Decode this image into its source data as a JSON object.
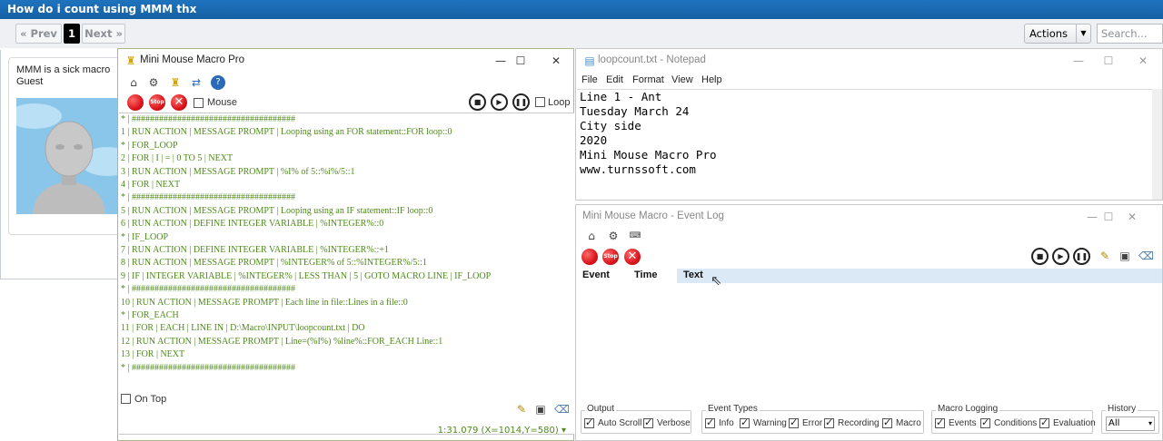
{
  "forum": {
    "title": "How do i count using MMM thx",
    "prev": "« Prev",
    "page": "1",
    "next": "Next »",
    "actions": "Actions",
    "search_placeholder": "Search...",
    "post_line1": "MMM is a sick macro",
    "post_line2": "Guest"
  },
  "mmm": {
    "title": "Mini Mouse Macro Pro",
    "mouse_label": "Mouse",
    "loop_label": "Loop",
    "on_top_label": "On Top",
    "status": "1:31.079  (X=1014,Y=580)",
    "status_arrow": "▾",
    "lines": [
      "* | ####################################",
      "1 | RUN ACTION | MESSAGE PROMPT | Looping using an FOR statement::FOR loop::0",
      "* | FOR_LOOP",
      "2 | FOR | I | = | 0 TO 5 | NEXT",
      "3 | RUN ACTION | MESSAGE PROMPT | %I% of 5::%i%/5::1",
      "4 | FOR | NEXT",
      "* | ####################################",
      "5 | RUN ACTION | MESSAGE PROMPT | Looping using an IF statement::IF loop::0",
      "6 | RUN ACTION | DEFINE INTEGER VARIABLE | %INTEGER%::0",
      "* | IF_LOOP",
      "7 | RUN ACTION | DEFINE INTEGER VARIABLE | %INTEGER%::+1",
      "8 | RUN ACTION | MESSAGE PROMPT | %INTEGER% of 5::%INTEGER%/5::1",
      "9 | IF | INTEGER VARIABLE | %INTEGER% | LESS THAN | 5 | GOTO MACRO LINE | IF_LOOP",
      "* | ####################################",
      "10 | RUN ACTION | MESSAGE PROMPT | Each line in file::Lines in a file::0",
      "* | FOR_EACH",
      "11 | FOR | EACH | LINE IN | D:\\Macro\\INPUT\\loopcount.txt | DO",
      "12 | RUN ACTION | MESSAGE PROMPT | Line=(%I%) %line%::FOR_EACH Line::1",
      "13 | FOR | NEXT",
      "* | ####################################"
    ]
  },
  "notepad": {
    "title": "loopcount.txt - Notepad",
    "menu": [
      "File",
      "Edit",
      "Format",
      "View",
      "Help"
    ],
    "lines": [
      "Line 1 - Ant",
      "Tuesday March 24",
      "City side",
      "2020",
      "Mini Mouse Macro Pro",
      "www.turnssoft.com"
    ]
  },
  "eventlog": {
    "title": "Mini Mouse Macro - Event Log",
    "columns": [
      "Event",
      "Time",
      "Text"
    ],
    "output_group": "Output",
    "output_items": [
      "Auto Scroll",
      "Verbose"
    ],
    "types_group": "Event Types",
    "types_items": [
      "Info",
      "Warning",
      "Error",
      "Recording",
      "Macro"
    ],
    "logging_group": "Macro Logging",
    "logging_items": [
      "Events",
      "Conditions",
      "Evaluation"
    ],
    "history_group": "History",
    "history_value": "All"
  },
  "window_controls": {
    "minimize": "—",
    "maximize": "☐",
    "close": "✕"
  },
  "colors": {
    "macro_text": "#4e8a1a",
    "forum_header": "#1e73be",
    "selected_header": "#dbe9f7"
  }
}
